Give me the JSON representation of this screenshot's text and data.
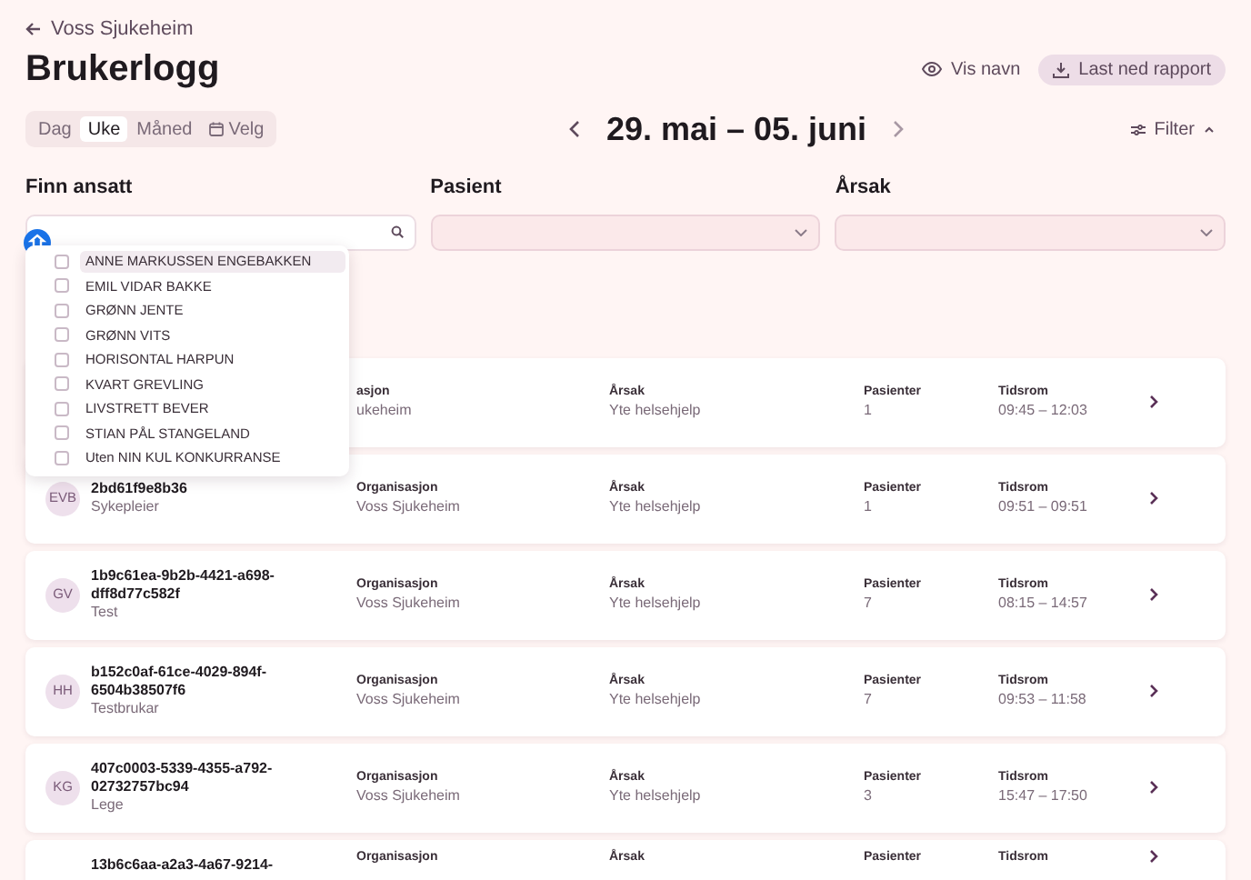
{
  "back_link": {
    "label": "Voss Sjukeheim"
  },
  "title": "Brukerlogg",
  "actions": [
    {
      "kind": "eye",
      "label": "Vis navn"
    },
    {
      "kind": "download",
      "label": "Last ned rapport"
    }
  ],
  "period_tabs": [
    {
      "label": "Dag",
      "selected": false
    },
    {
      "label": "Uke",
      "selected": true
    },
    {
      "label": "Måned",
      "selected": false
    },
    {
      "label": "Velg",
      "selected": false,
      "kind": "calendar"
    }
  ],
  "date_range": "29. mai – 05. juni",
  "filter_toggle": {
    "label": "Filter",
    "expanded": true
  },
  "filters": [
    {
      "label": "Finn ansatt",
      "kind": "search"
    },
    {
      "label": "Pasient",
      "kind": "select"
    },
    {
      "label": "Årsak",
      "kind": "select"
    }
  ],
  "employee_dropdown": [
    {
      "label": "ANNE MARKUSSEN ENGEBAKKEN",
      "checked": false,
      "selected": true
    },
    {
      "label": "EMIL VIDAR BAKKE",
      "checked": false,
      "selected": false
    },
    {
      "label": "GRØNN JENTE",
      "checked": false,
      "selected": false
    },
    {
      "label": "GRØNN VITS",
      "checked": false,
      "selected": false
    },
    {
      "label": "HORISONTAL HARPUN",
      "checked": false,
      "selected": false
    },
    {
      "label": "KVART GREVLING",
      "checked": false,
      "selected": false
    },
    {
      "label": "LIVSTRETT BEVER",
      "checked": false,
      "selected": false
    },
    {
      "label": "STIAN PÅL STANGELAND",
      "checked": false,
      "selected": false
    },
    {
      "label": "Uten NIN KUL KONKURRANSE",
      "checked": false,
      "selected": false
    }
  ],
  "log_rows": [
    {
      "org_label": "asjon",
      "org": "ukeheim",
      "reason_label": "Årsak",
      "reason": "Yte helsehjelp",
      "patients_label": "Pasienter",
      "patients": "1",
      "time_label": "Tidsrom",
      "time": "09:45 – 12:03"
    },
    {
      "initials": "EVB",
      "name": "2bd61f9e8b36",
      "role": "Sykepleier",
      "org_label": "Organisasjon",
      "org": "Voss Sjukeheim",
      "reason_label": "Årsak",
      "reason": "Yte helsehjelp",
      "patients_label": "Pasienter",
      "patients": "1",
      "time_label": "Tidsrom",
      "time": "09:51 – 09:51"
    },
    {
      "initials": "GV",
      "name": "1b9c61ea-9b2b-4421-a698-dff8d77c582f",
      "role": "Test",
      "org_label": "Organisasjon",
      "org": "Voss Sjukeheim",
      "reason_label": "Årsak",
      "reason": "Yte helsehjelp",
      "patients_label": "Pasienter",
      "patients": "7",
      "time_label": "Tidsrom",
      "time": "08:15 – 14:57"
    },
    {
      "initials": "HH",
      "name": "b152c0af-61ce-4029-894f-6504b38507f6",
      "role": "Testbrukar",
      "org_label": "Organisasjon",
      "org": "Voss Sjukeheim",
      "reason_label": "Årsak",
      "reason": "Yte helsehjelp",
      "patients_label": "Pasienter",
      "patients": "7",
      "time_label": "Tidsrom",
      "time": "09:53 – 11:58"
    },
    {
      "initials": "KG",
      "name": "407c0003-5339-4355-a792-02732757bc94",
      "role": "Lege",
      "org_label": "Organisasjon",
      "org": "Voss Sjukeheim",
      "reason_label": "Årsak",
      "reason": "Yte helsehjelp",
      "patients_label": "Pasienter",
      "patients": "3",
      "time_label": "Tidsrom",
      "time": "15:47 – 17:50"
    },
    {
      "name": "13b6c6aa-a2a3-4a67-9214-",
      "org_label": "Organisasjon",
      "reason_label": "Årsak",
      "patients_label": "Pasienter",
      "time_label": "Tidsrom"
    }
  ]
}
